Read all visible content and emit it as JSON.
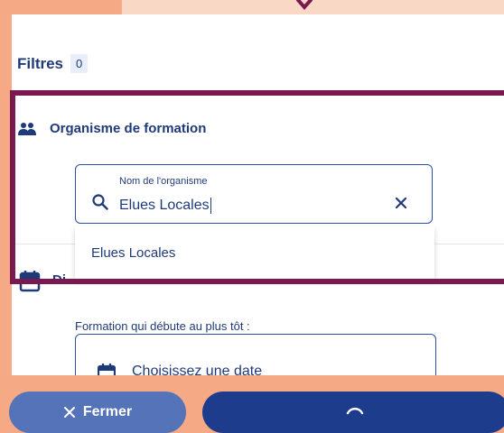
{
  "filters": {
    "title": "Filtres",
    "count": "0"
  },
  "organism_section": {
    "title": "Organisme de formation",
    "search": {
      "label": "Nom de l'organisme",
      "value": "Elues Locales"
    },
    "suggestions": [
      "Elues Locales"
    ]
  },
  "date_section": {
    "title_fragment": "Di",
    "start_label": "Formation qui débute au plus tôt :",
    "placeholder": "Choisissez une date"
  },
  "footer": {
    "close_label": "Fermer"
  },
  "colors": {
    "primary": "#1e3c8c",
    "highlight": "#7a1851",
    "close_button": "#5573b8",
    "background": "#f6a985"
  }
}
